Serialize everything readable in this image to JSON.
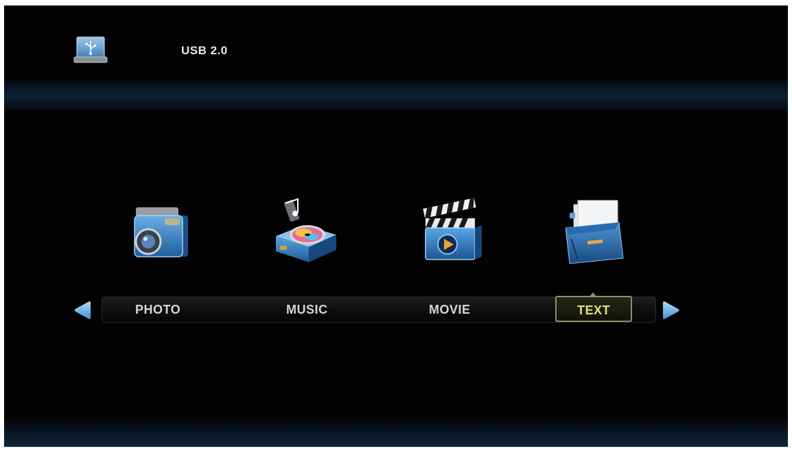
{
  "header": {
    "source_label": "USB 2.0",
    "source_icon": "usb-drive-icon"
  },
  "menu": {
    "items": [
      {
        "label": "PHOTO",
        "icon": "camera-icon"
      },
      {
        "label": "MUSIC",
        "icon": "music-disc-icon"
      },
      {
        "label": "MOVIE",
        "icon": "clapperboard-icon"
      },
      {
        "label": "TEXT",
        "icon": "document-folder-icon"
      }
    ],
    "selected_index": 3,
    "prev_icon": "arrow-left-icon",
    "next_icon": "arrow-right-icon"
  },
  "colors": {
    "background": "#020203",
    "selected_text": "#e3e07a",
    "menu_text": "#d6d6d6",
    "arrow": "#7fb8e6"
  }
}
